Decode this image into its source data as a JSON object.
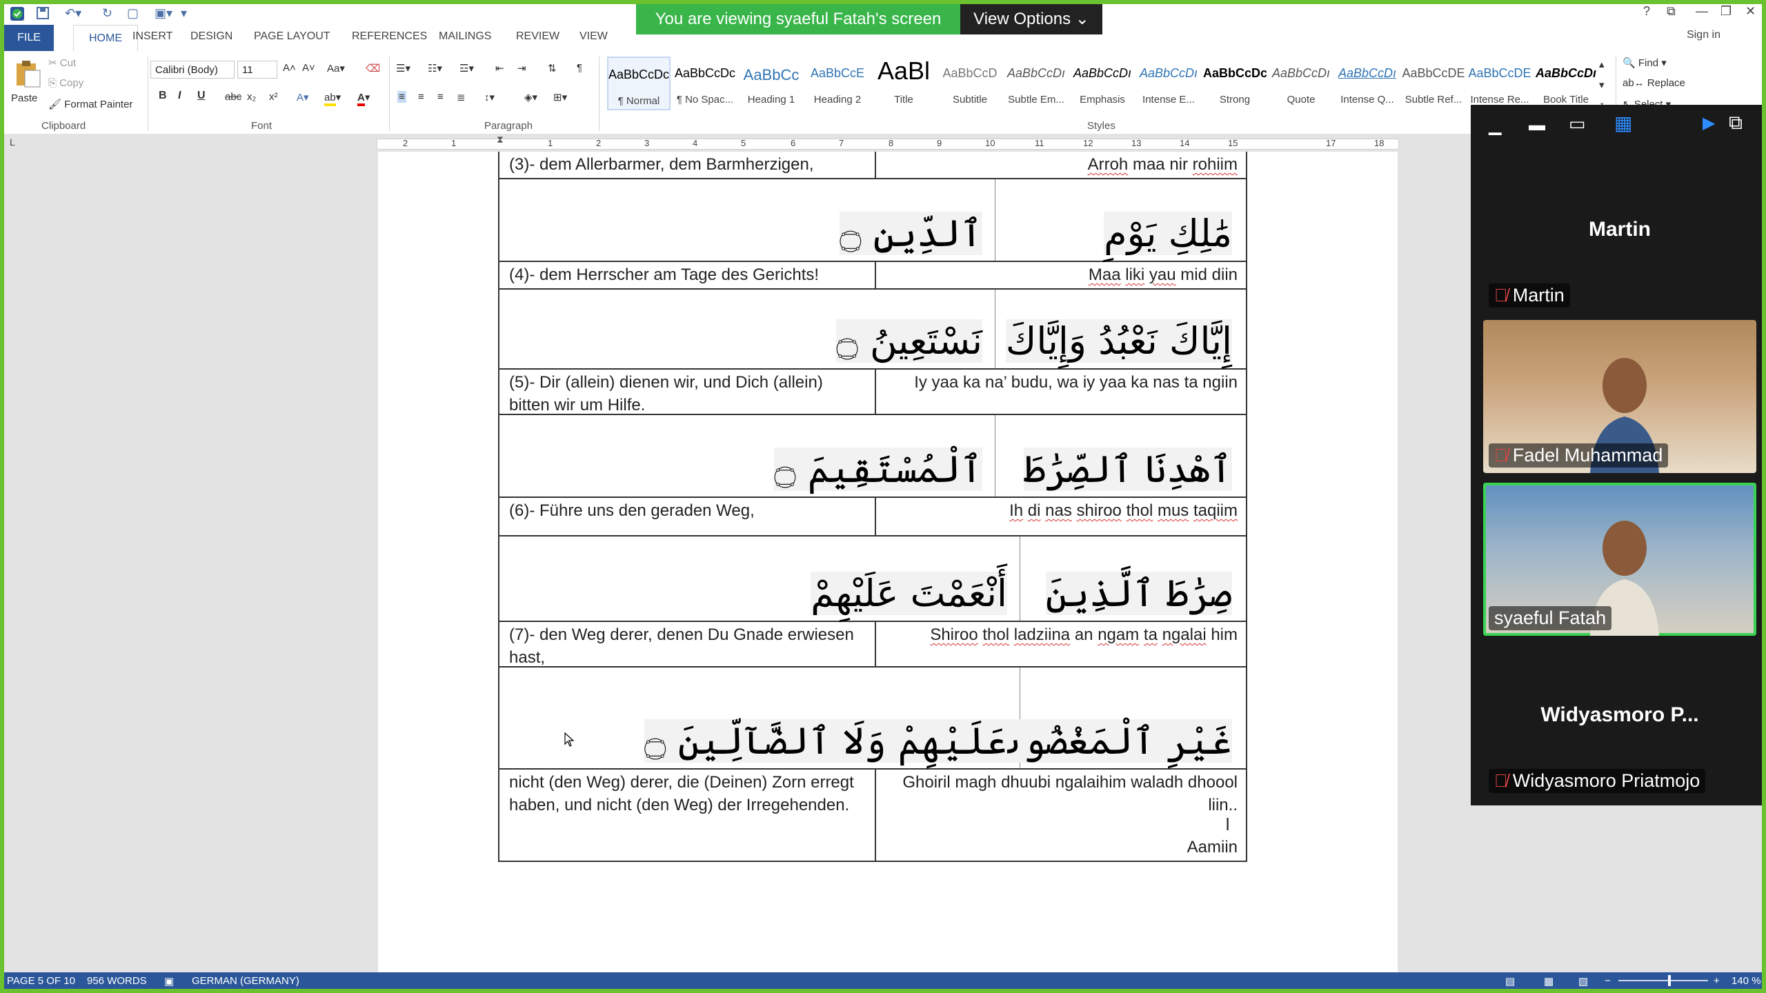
{
  "share_banner": {
    "text": "You are viewing syaeful  Fatah's screen",
    "options_label": "View Options"
  },
  "ribbon_tabs": [
    "FILE",
    "HOME",
    "INSERT",
    "DESIGN",
    "PAGE LAYOUT",
    "REFERENCES",
    "MAILINGS",
    "REVIEW",
    "VIEW"
  ],
  "signin": "Sign in",
  "clipboard": {
    "paste": "Paste",
    "cut": "Cut",
    "copy": "Copy",
    "format_painter": "Format Painter",
    "group": "Clipboard"
  },
  "font": {
    "family": "Calibri (Body)",
    "size": "11",
    "group": "Font"
  },
  "paragraph": {
    "group": "Paragraph"
  },
  "styles": {
    "group": "Styles",
    "items": [
      {
        "sample": "AaBbCcDc",
        "label": "¶ Normal"
      },
      {
        "sample": "AaBbCcDc",
        "label": "¶ No Spac..."
      },
      {
        "sample": "AaBbCc",
        "label": "Heading 1"
      },
      {
        "sample": "AaBbCcE",
        "label": "Heading 2"
      },
      {
        "sample": "AaBl",
        "label": "Title"
      },
      {
        "sample": "AaBbCcD",
        "label": "Subtitle"
      },
      {
        "sample": "AaBbCcDı",
        "label": "Subtle Em..."
      },
      {
        "sample": "AaBbCcDı",
        "label": "Emphasis"
      },
      {
        "sample": "AaBbCcDı",
        "label": "Intense E..."
      },
      {
        "sample": "AaBbCcDc",
        "label": "Strong"
      },
      {
        "sample": "AaBbCcDı",
        "label": "Quote"
      },
      {
        "sample": "AaBbCcDı",
        "label": "Intense Q..."
      },
      {
        "sample": "AaBbCcDE",
        "label": "Subtle Ref..."
      },
      {
        "sample": "AaBbCcDE",
        "label": "Intense Re..."
      },
      {
        "sample": "AaBbCcDı",
        "label": "Book Title"
      }
    ]
  },
  "editing": {
    "find": "Find",
    "replace": "Replace",
    "select": "Select"
  },
  "ruler_numbers": [
    "2",
    "1",
    "1",
    "2",
    "3",
    "4",
    "5",
    "6",
    "7",
    "8",
    "9",
    "10",
    "11",
    "12",
    "13",
    "14",
    "15",
    "17",
    "18"
  ],
  "doc": {
    "rows": [
      {
        "de": "(3)- dem Allerbarmer, dem Barmherzigen,",
        "tr": "Arroh maa nir rohiim"
      },
      {
        "ar_right": "مَٰلِكِ يَوْمِ",
        "ar_left": "ٱلدِّينِ ۝"
      },
      {
        "de": "(4)- dem Herrscher am Tage des Gerichts!",
        "tr": "Maa liki yau mid diin"
      },
      {
        "ar_right": "إِيَّاكَ نَعْبُدُ وَإِيَّاكَ",
        "ar_left": "نَسْتَعِينُ ۝"
      },
      {
        "de": "(5)- Dir (allein) dienen wir, und Dich (allein) bitten wir um Hilfe.",
        "tr": "Iy yaa ka na’ budu, wa iy yaa ka nas ta ngiin"
      },
      {
        "ar_right": "ٱهْدِنَا ٱلصِّرَٰطَ",
        "ar_left": "ٱلْمُسْتَقِيمَ ۝"
      },
      {
        "de": "(6)- Führe uns den geraden Weg,",
        "tr": "Ih di nas shiroo thol mus taqiim"
      },
      {
        "ar_right": "صِرَٰطَ ٱلَّذِينَ",
        "ar_left": "أَنْعَمْتَ عَلَيْهِمْ"
      },
      {
        "de": " (7)- den Weg derer, denen Du Gnade erwiesen hast,",
        "tr": "Shiroo thol ladziina an ngam ta ngalai him"
      },
      {
        "ar_right": "غَيْرِ ٱلْمَغْضُوبِ",
        "ar_left": "عَلَيْهِمْ وَلَا ٱلضَّآلِّينَ ۝"
      },
      {
        "de": "nicht (den Weg) derer, die (Deinen) Zorn erregt haben, und nicht (den Weg) der Irregehenden.",
        "tr": "Ghoiril magh dhuubi ngalaihim   waladh dhoool liin..",
        "tr2": "Aamiin"
      }
    ]
  },
  "status": {
    "page": "PAGE 5 OF 10",
    "words": "956 WORDS",
    "language": "GERMAN (GERMANY)",
    "zoom": "140 %"
  },
  "zoom_panel": {
    "participants": [
      {
        "name": "Martin",
        "big": "Martin",
        "video": false,
        "muted": true
      },
      {
        "name": "Fadel Muhammad",
        "video": true,
        "muted": true
      },
      {
        "name": "syaeful  Fatah",
        "video": true,
        "muted": false,
        "active": true
      },
      {
        "name": "Widyasmoro Priatmojo",
        "big": "Widyasmoro P...",
        "video": false,
        "muted": true
      }
    ]
  }
}
